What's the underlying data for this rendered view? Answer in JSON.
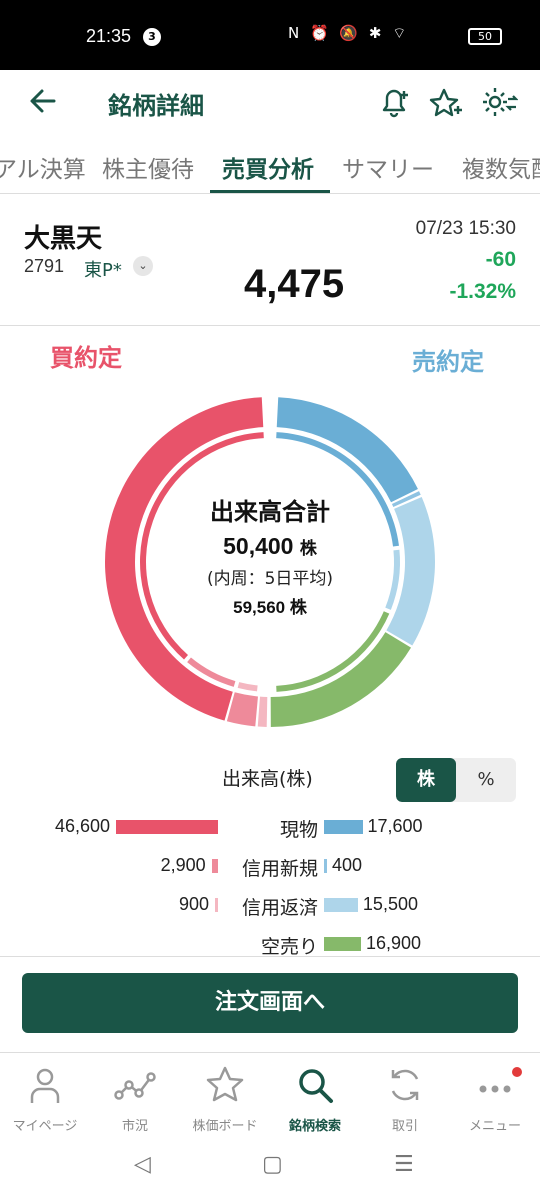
{
  "status_bar": {
    "time": "21:35",
    "notification_count": "3",
    "battery": "50",
    "icons": "N ⏰ 🔕 ✱ ⌔"
  },
  "appbar": {
    "title": "銘柄詳細"
  },
  "tabs": [
    {
      "label": "アル決算"
    },
    {
      "label": "株主優待"
    },
    {
      "label": "売買分析",
      "active": true
    },
    {
      "label": "サマリー"
    },
    {
      "label": "複数気配"
    }
  ],
  "stock": {
    "name": "大黒天",
    "code": "2791",
    "market": "東P*",
    "price": "4,475",
    "datetime": "07/23 15:30",
    "change": "-60",
    "change_pct": "-1.32%"
  },
  "analysis": {
    "buy_label": "買約定",
    "sell_label": "売約定",
    "center_title": "出来高合計",
    "total": "50,400",
    "unit": "株",
    "inner_note": "(内周：5日平均)",
    "avg_total": "59,560",
    "volume_label": "出来高(株)",
    "toggle_share": "株",
    "toggle_pct": "%"
  },
  "chart_data": {
    "type": "donut",
    "outer_buy": [
      {
        "name": "現物",
        "value": 46600,
        "color": "#e8536a"
      },
      {
        "name": "信用新規",
        "value": 2900,
        "color": "#ee8a9a"
      },
      {
        "name": "信用返済",
        "value": 900,
        "color": "#f4b7c1"
      }
    ],
    "outer_sell": [
      {
        "name": "現物",
        "value": 17600,
        "color": "#6aaed5"
      },
      {
        "name": "信用新規",
        "value": 400,
        "color": "#8fc3e2"
      },
      {
        "name": "信用返済",
        "value": 15500,
        "color": "#aed5ea"
      },
      {
        "name": "空売り",
        "value": 16900,
        "color": "#86b96a"
      }
    ]
  },
  "rows": [
    {
      "left_value": "46,600",
      "category": "現物",
      "right_value": "17,600",
      "left_color": "#e8536a",
      "right_color": "#6aaed5"
    },
    {
      "left_value": "2,900",
      "category": "信用新規",
      "right_value": "400",
      "left_color": "#ee8a9a",
      "right_color": "#8fc3e2"
    },
    {
      "left_value": "900",
      "category": "信用返済",
      "right_value": "15,500",
      "left_color": "#f4b7c1",
      "right_color": "#aed5ea"
    },
    {
      "left_value": "",
      "category": "空売り",
      "right_value": "16,900",
      "left_color": "#e8536a",
      "right_color": "#86b96a"
    }
  ],
  "order_button": "注文画面へ",
  "bottom_nav": [
    {
      "label": "マイページ",
      "icon": "person-icon"
    },
    {
      "label": "市況",
      "icon": "market-line-icon"
    },
    {
      "label": "株価ボード",
      "icon": "star-outline-icon"
    },
    {
      "label": "銘柄検索",
      "icon": "search-icon",
      "active": true
    },
    {
      "label": "取引",
      "icon": "trade-cycle-icon"
    },
    {
      "label": "メニュー",
      "icon": "more-dots-icon"
    }
  ],
  "colors": {
    "brand": "#1a5547",
    "buy": "#e8536a",
    "sell": "#6aaed5",
    "up": "#1fa65a"
  }
}
